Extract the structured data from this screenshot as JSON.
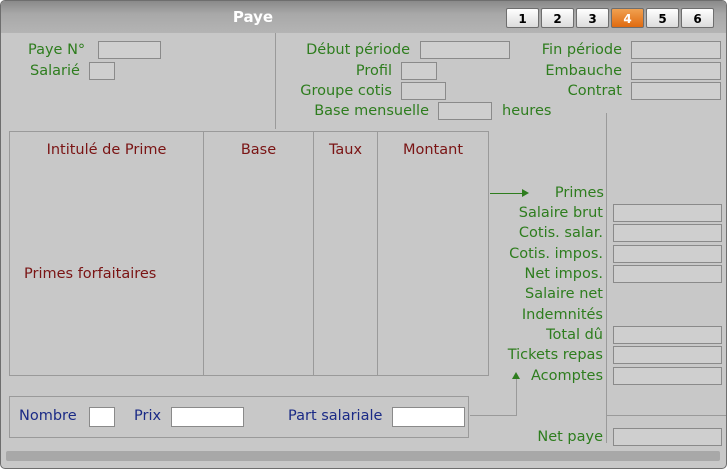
{
  "window": {
    "title": "Paye"
  },
  "tabs": [
    "1",
    "2",
    "3",
    "4",
    "5",
    "6"
  ],
  "active_tab": "4",
  "header": {
    "paye_no_label": "Paye N°",
    "salarie_label": "Salarié",
    "debut_periode_label": "Début période",
    "profil_label": "Profil",
    "groupe_cotis_label": "Groupe cotis",
    "base_mensuelle_label": "Base mensuelle",
    "heures_label": "heures",
    "fin_periode_label": "Fin période",
    "embauche_label": "Embauche",
    "contrat_label": "Contrat"
  },
  "primes_table": {
    "columns": [
      "Intitulé de Prime",
      "Base",
      "Taux",
      "Montant"
    ],
    "row_label": "Primes forfaitaires"
  },
  "bottom_form": {
    "nombre_label": "Nombre",
    "prix_label": "Prix",
    "part_salariale_label": "Part salariale"
  },
  "summary": {
    "primes": "Primes",
    "salaire_brut": "Salaire brut",
    "cotis_salar": "Cotis. salar.",
    "cotis_impos": "Cotis. impos.",
    "net_impos": "Net impos.",
    "salaire_net": "Salaire net",
    "indemnites": "Indemnités",
    "total_du": "Total dû",
    "tickets_repas": "Tickets repas",
    "acomptes": "Acomptes",
    "net_paye": "Net paye"
  },
  "colors": {
    "label_green": "#2e7d1e",
    "label_red": "#7a1414",
    "label_blue": "#1a2a86",
    "active_tab": "#e06a10"
  }
}
